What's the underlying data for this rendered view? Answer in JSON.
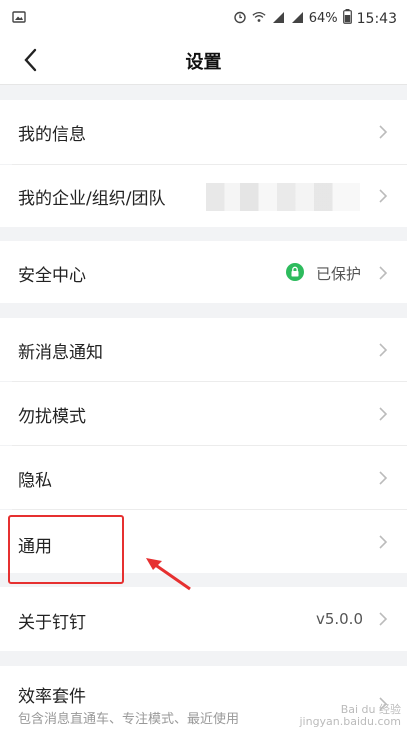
{
  "status_bar": {
    "battery": "64%",
    "time": "15:43"
  },
  "nav": {
    "title": "设置"
  },
  "items": {
    "my_info": {
      "label": "我的信息"
    },
    "my_org": {
      "label": "我的企业/组织/团队"
    },
    "security": {
      "label": "安全中心",
      "value": "已保护"
    },
    "notifications": {
      "label": "新消息通知"
    },
    "dnd": {
      "label": "勿扰模式"
    },
    "privacy": {
      "label": "隐私"
    },
    "general": {
      "label": "通用"
    },
    "about": {
      "label": "关于钉钉",
      "value": "v5.0.0"
    },
    "efficiency": {
      "label": "效率套件",
      "sub_label": "包含消息直通车、专注模式、最近使用"
    }
  },
  "colors": {
    "accent_green": "#2dbb5d",
    "highlight_red": "#e63030"
  },
  "watermark": {
    "line1": "Bai du 经验",
    "line2": "jingyan.baidu.com"
  }
}
